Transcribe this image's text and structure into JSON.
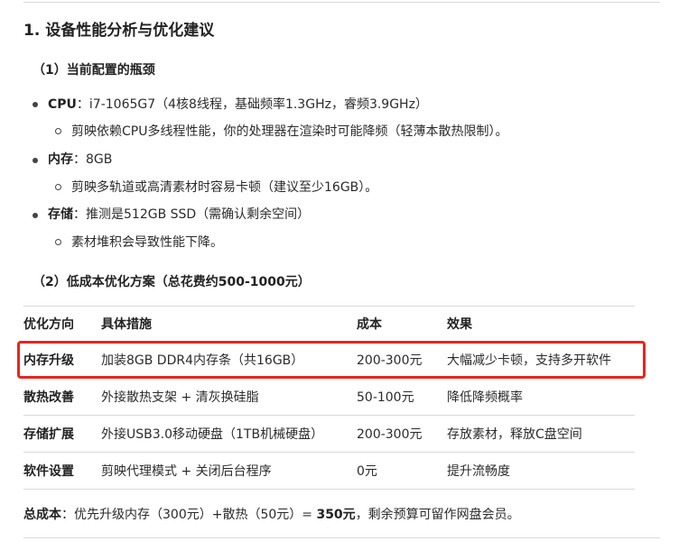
{
  "heading": "1. 设备性能分析与优化建议",
  "section1": {
    "title": "（1）当前配置的瓶颈",
    "items": [
      {
        "label": "CPU",
        "sep": "：",
        "text": "i7-1065G7（4核8线程，基础频率1.3GHz，睿频3.9GHz）",
        "sub": "剪映依赖CPU多线程性能，你的处理器在渲染时可能降频（轻薄本散热限制）。"
      },
      {
        "label": "内存",
        "sep": "：",
        "text": "8GB",
        "sub": "剪映多轨道或高清素材时容易卡顿（建议至少16GB）。"
      },
      {
        "label": "存储",
        "sep": "：",
        "text": "推测是512GB SSD（需确认剩余空间）",
        "sub": "素材堆积会导致性能下降。"
      }
    ]
  },
  "section2": {
    "title": "（2）低成本优化方案（总花费约500-1000元）",
    "table": {
      "headers": [
        "优化方向",
        "具体措施",
        "成本",
        "效果"
      ],
      "rows": [
        [
          "内存升级",
          "加装8GB DDR4内存条（共16GB）",
          "200-300元",
          "大幅减少卡顿，支持多开软件"
        ],
        [
          "散热改善",
          "外接散热支架 + 清灰换硅脂",
          "50-100元",
          "降低降频概率"
        ],
        [
          "存储扩展",
          "外接USB3.0移动硬盘（1TB机械硬盘）",
          "200-300元",
          "存放素材，释放C盘空间"
        ],
        [
          "软件设置",
          "剪映代理模式 + 关闭后台程序",
          "0元",
          "提升流畅度"
        ]
      ]
    }
  },
  "total": {
    "label": "总成本",
    "text": "：优先升级内存（300元）+散热（50元）= ",
    "amount": "350元",
    "tail": "，剩余预算可留作网盘会员。"
  },
  "colors": {
    "highlight": "#e8251f",
    "rule": "#d9d9d9"
  }
}
